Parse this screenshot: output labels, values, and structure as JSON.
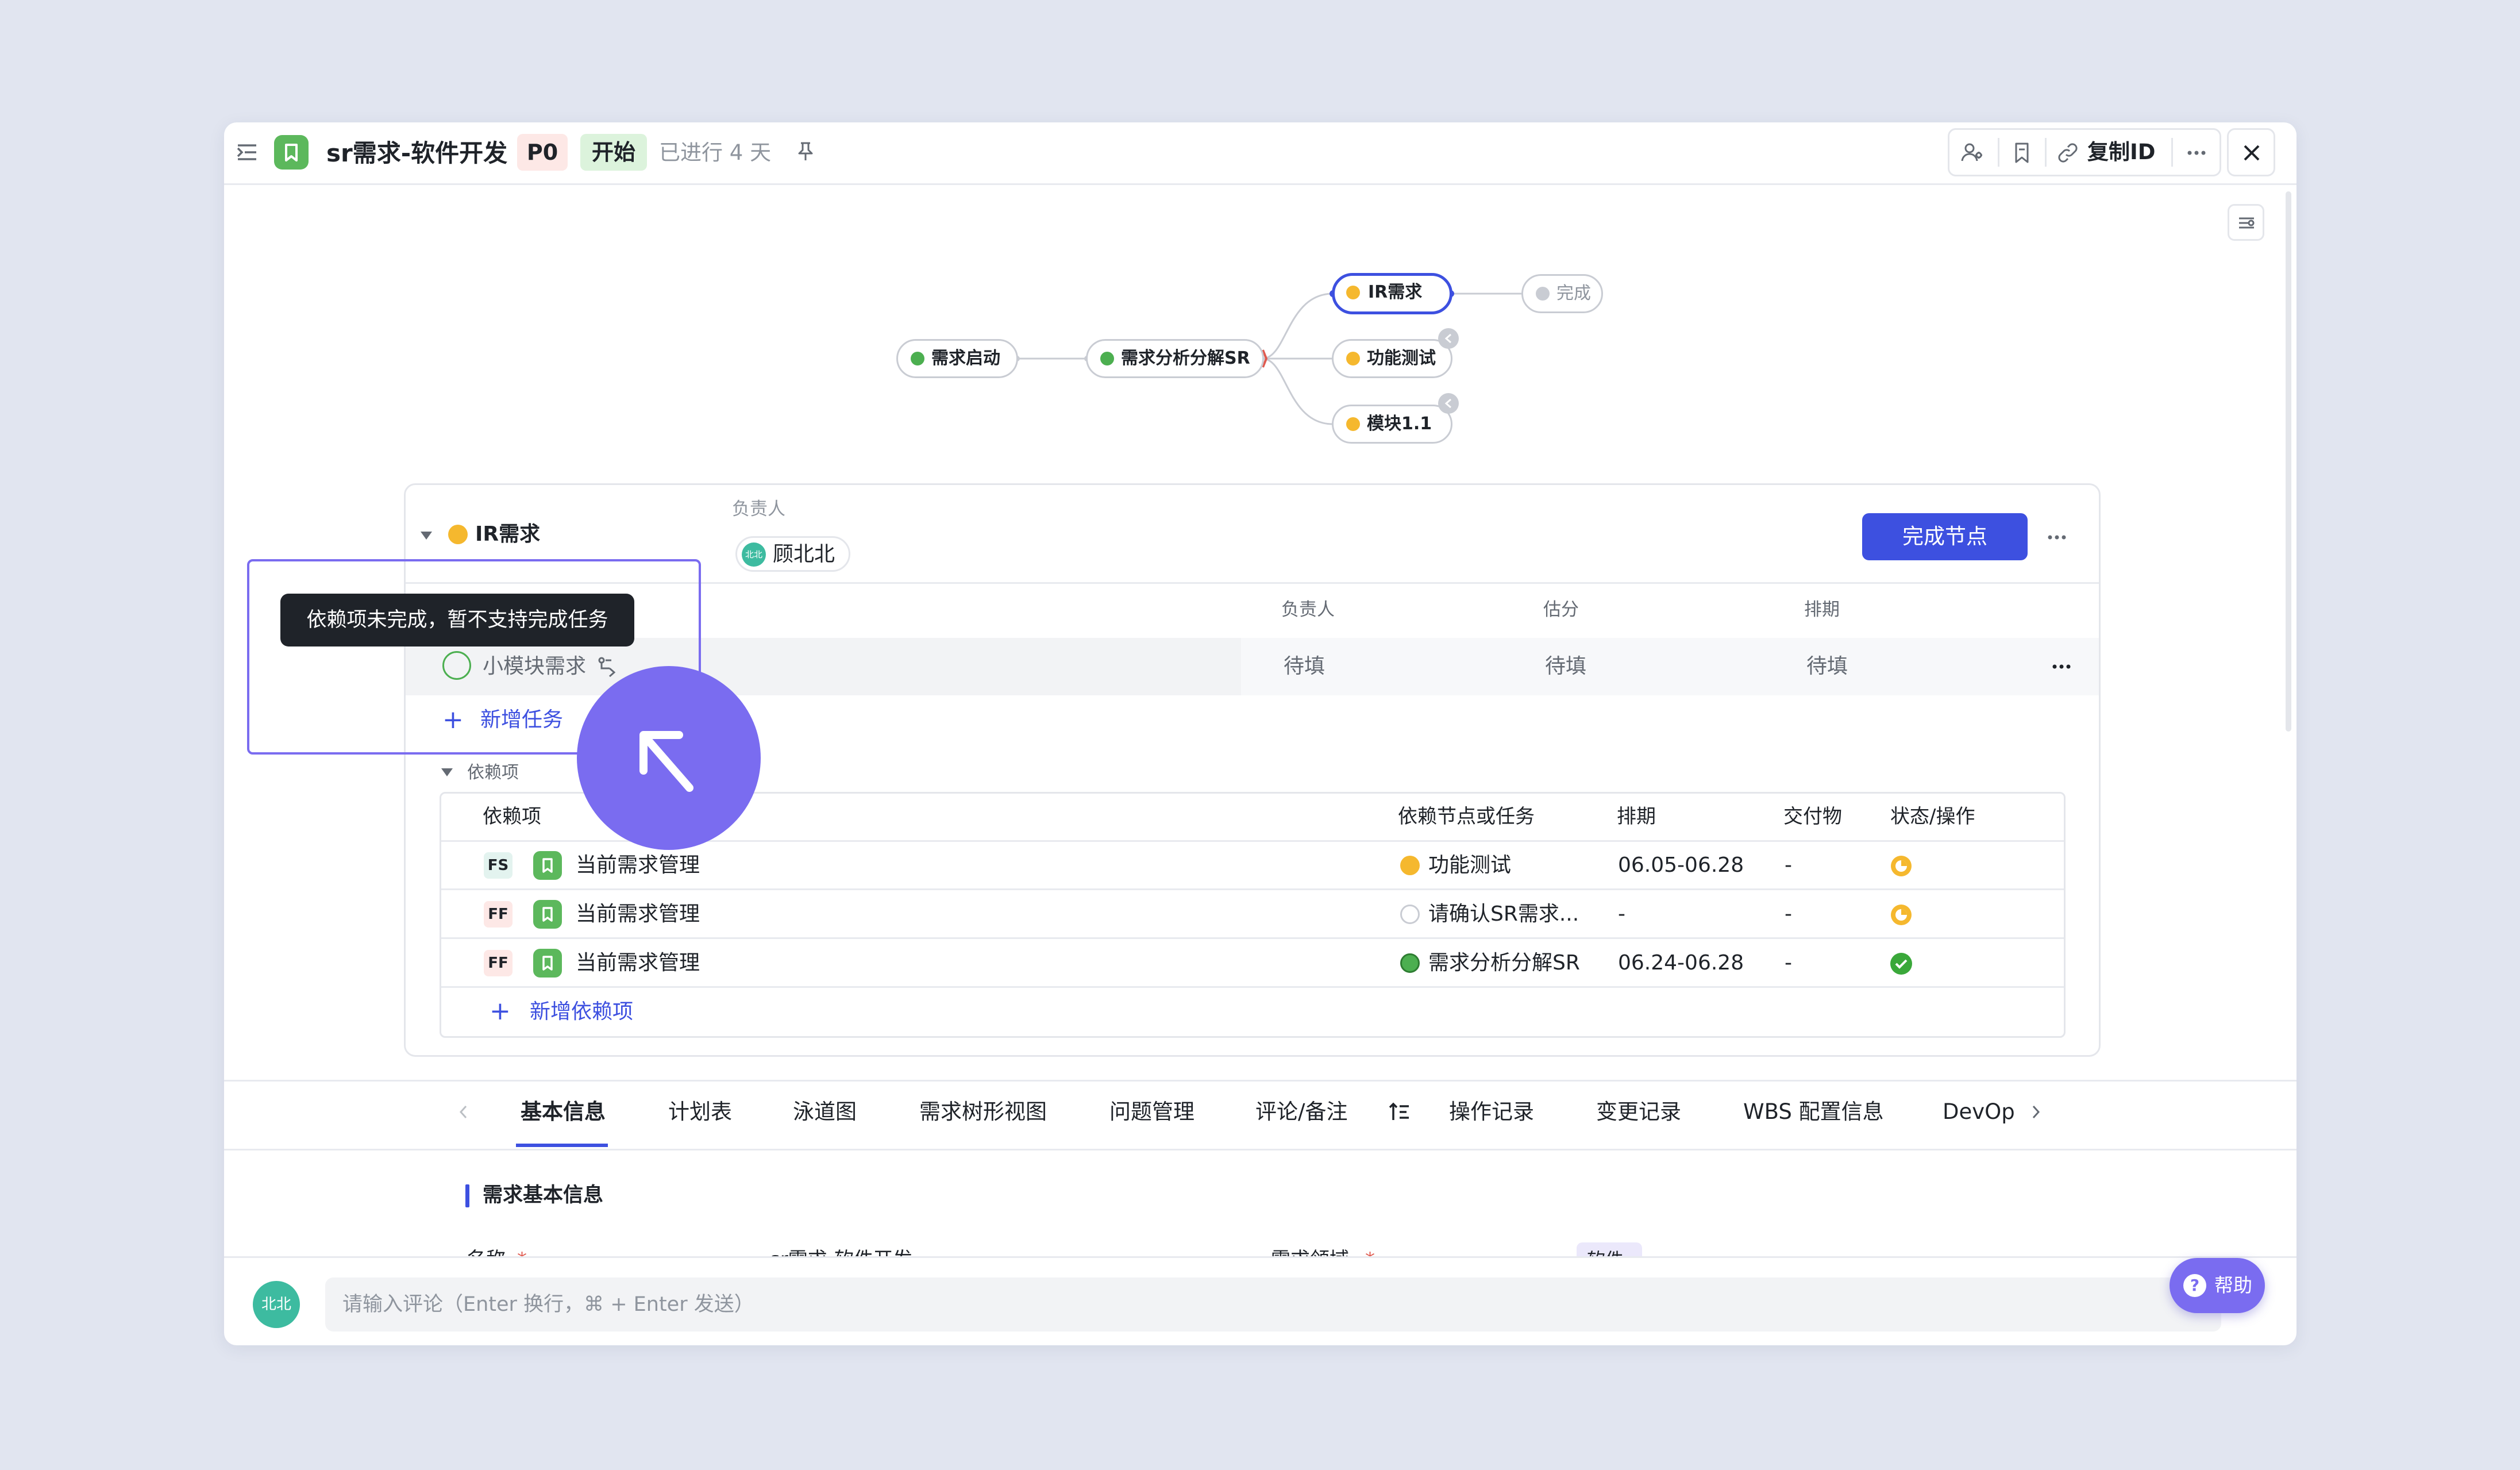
{
  "header": {
    "title": "sr需求-软件开发",
    "priority": "P0",
    "status": "开始",
    "progress_text": "已进行 4 天",
    "copy_id": "复制ID"
  },
  "flow": {
    "nodes": [
      {
        "label": "需求启动",
        "color": "#4caf50"
      },
      {
        "label": "需求分析分解SR",
        "color": "#4caf50"
      },
      {
        "label": "IR需求",
        "color": "#f5b82e"
      },
      {
        "label": "完成",
        "color": "#c9ccd3"
      },
      {
        "label": "功能测试",
        "color": "#f5b82e"
      },
      {
        "label": "模块1.1",
        "color": "#f5b82e"
      }
    ]
  },
  "node_panel": {
    "name": "IR需求",
    "owner_label": "负责人",
    "owner_avatar": "北北",
    "owner_name": "顾北北",
    "complete_button": "完成节点",
    "task_columns": {
      "owner": "负责人",
      "estimate": "估分",
      "schedule": "排期"
    },
    "task": {
      "name": "小模块需求",
      "owner": "待填",
      "estimate": "待填",
      "schedule": "待填"
    },
    "add_task": "新增任务",
    "tooltip": "依赖项未完成，暂不支持完成任务"
  },
  "dependencies": {
    "section_title": "依赖项",
    "columns": [
      "依赖项",
      "依赖节点或任务",
      "排期",
      "交付物",
      "状态/操作"
    ],
    "rows": [
      {
        "type": "FS",
        "name": "当前需求管理",
        "node": "功能测试",
        "node_color": "#f5b82e",
        "schedule": "06.05-06.28",
        "deliverable": "-",
        "status": "in-progress"
      },
      {
        "type": "FF",
        "name": "当前需求管理",
        "node": "请确认SR需求...",
        "node_color": "#ffffff",
        "schedule": "-",
        "deliverable": "-",
        "status": "in-progress"
      },
      {
        "type": "FF",
        "name": "当前需求管理",
        "node": "需求分析分解SR",
        "node_color": "#4caf50",
        "schedule": "06.24-06.28",
        "deliverable": "-",
        "status": "done"
      }
    ],
    "add_dependency": "新增依赖项"
  },
  "tabs": [
    "基本信息",
    "计划表",
    "泳道图",
    "需求树形视图",
    "问题管理",
    "评论/备注",
    "操作记录",
    "变更记录",
    "WBS 配置信息",
    "DevOp"
  ],
  "basic_info": {
    "section_title": "需求基本信息",
    "name_label": "名称",
    "name_value": "sr需求-软件开发",
    "domain_label": "需求领域",
    "domain_value": "软件"
  },
  "comment": {
    "avatar": "北北",
    "placeholder": "请输入评论（Enter 换行，⌘ + Enter 发送）"
  },
  "help_button": "帮助",
  "colors": {
    "accent": "#3d50e0",
    "cursor": "#7a6cf0",
    "success": "#3aa83a",
    "warning": "#f5b82e"
  }
}
